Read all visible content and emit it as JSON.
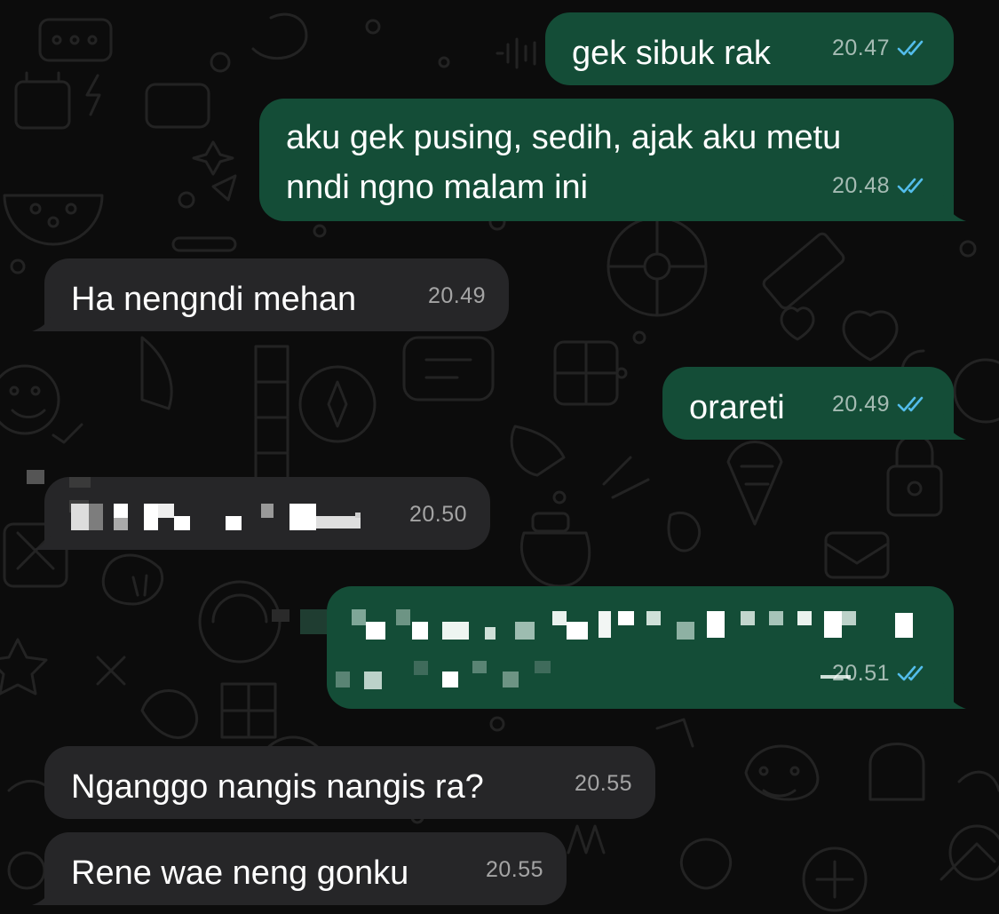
{
  "messages": [
    {
      "id": "m1",
      "direction": "out",
      "text": "gek sibuk rak",
      "time": "20.47",
      "status": "read-double-check-icon"
    },
    {
      "id": "m2",
      "direction": "out",
      "text": "aku gek pusing, sedih, ajak aku metu\nnndi ngno malam ini",
      "time": "20.48",
      "status": "read-double-check-icon"
    },
    {
      "id": "m3",
      "direction": "in",
      "text": "Ha nengndi mehan",
      "time": "20.49"
    },
    {
      "id": "m4",
      "direction": "out",
      "text": "orareti",
      "time": "20.49",
      "status": "read-double-check-icon"
    },
    {
      "id": "m5",
      "direction": "in",
      "text": "",
      "censored": true,
      "time": "20.50"
    },
    {
      "id": "m6",
      "direction": "out",
      "text": "",
      "censored": true,
      "time": "20.51",
      "status": "read-double-check-icon"
    },
    {
      "id": "m7",
      "direction": "in",
      "text": "Nganggo nangis nangis ra?",
      "time": "20.55"
    },
    {
      "id": "m8",
      "direction": "in",
      "text": "Rene wae neng gonku",
      "time": "20.55"
    }
  ],
  "colors": {
    "background": "#0c0c0c",
    "outgoing_bubble": "#144d37",
    "incoming_bubble": "#262628",
    "read_ticks": "#53bdeb",
    "wallpaper_doodle": "#232323"
  }
}
